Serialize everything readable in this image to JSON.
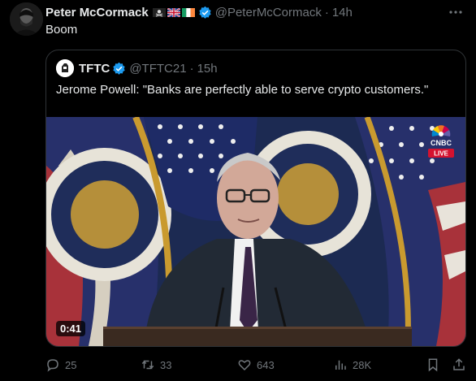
{
  "author": {
    "name": "Peter McCormack",
    "handle": "@PeterMcCormack",
    "time": "14h",
    "flag_icons": [
      "skull-crossbones-flag-icon",
      "uk-flag-icon",
      "ireland-flag-icon"
    ]
  },
  "tweet": {
    "text": "Boom"
  },
  "quoted": {
    "name": "TFTC",
    "handle": "@TFTC21",
    "time": "15h",
    "text": "Jerome Powell: \"Banks are perfectly able to serve crypto customers.\"",
    "video": {
      "duration": "0:41",
      "network_logo": "CNBC",
      "live_label": "LIVE"
    }
  },
  "actions": {
    "replies": "25",
    "reposts": "33",
    "likes": "643",
    "views": "28K"
  },
  "colors": {
    "background": "#000000",
    "text": "#e7e9ea",
    "muted": "#71767b",
    "verified": "#1d9bf0",
    "border": "#2f3336"
  }
}
